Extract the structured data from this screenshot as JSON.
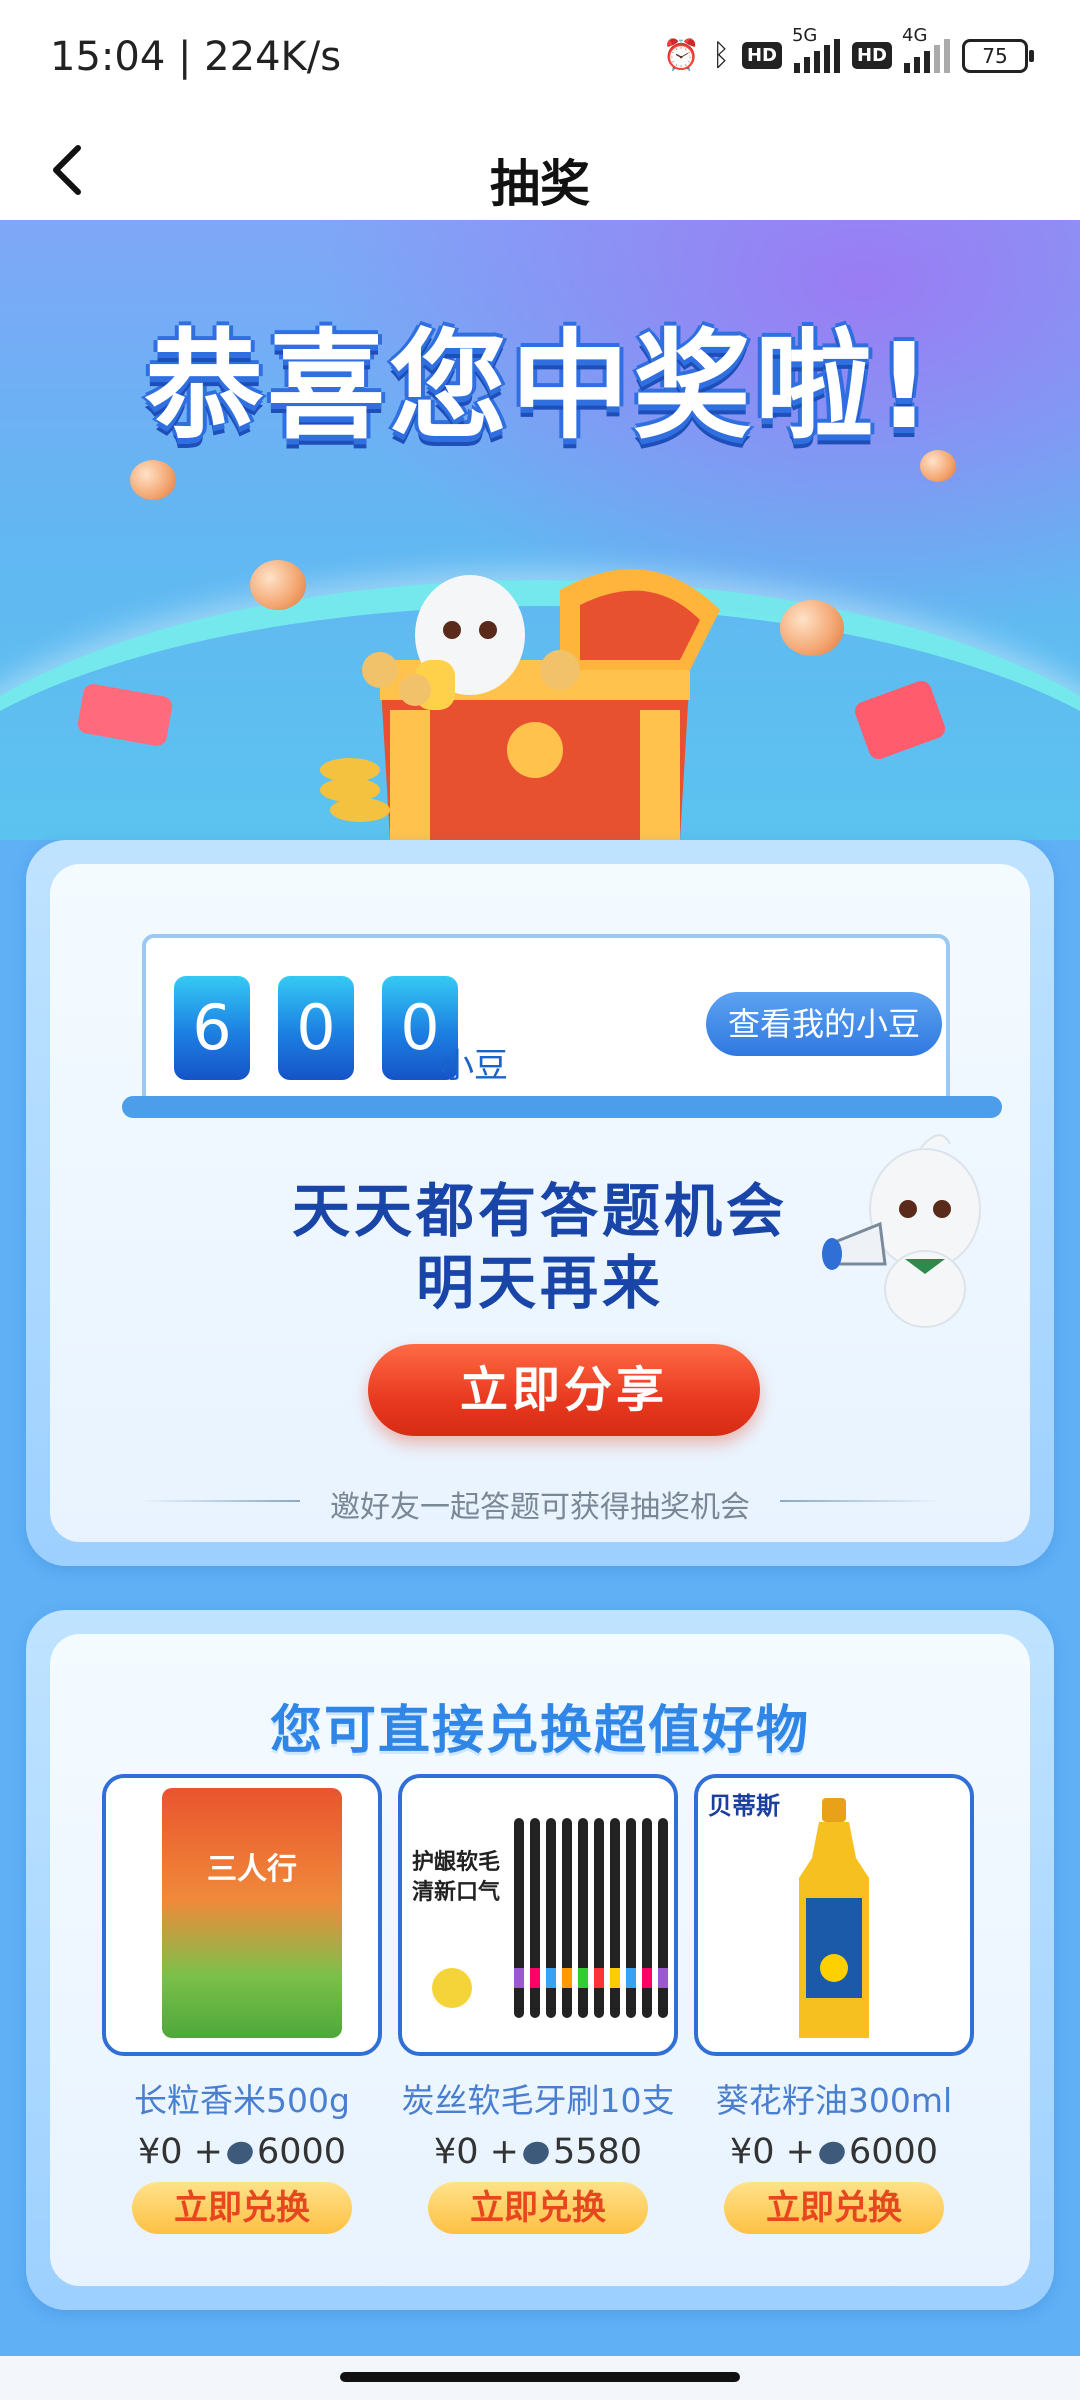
{
  "status_bar": {
    "time": "15:04 | 224K/s",
    "network_5g": "5G",
    "network_4g": "4G",
    "hd": "HD",
    "battery": "75"
  },
  "nav": {
    "title": "抽奖"
  },
  "hero": {
    "title": "恭喜您中奖啦!"
  },
  "score": {
    "digits": [
      "6",
      "0",
      "0"
    ],
    "unit": "小豆",
    "view_button": "查看我的小豆"
  },
  "message": {
    "line1": "天天都有答题机会",
    "line2": "明天再来"
  },
  "share": {
    "button": "立即分享",
    "hint": "邀好友一起答题可获得抽奖机会"
  },
  "exchange": {
    "title": "您可直接兑换超值好物",
    "products": [
      {
        "name": "长粒香米500g",
        "price": "¥0",
        "plus": "+",
        "beans": "6000",
        "button": "立即兑换",
        "brand": "三人行"
      },
      {
        "name": "炭丝软毛牙刷10支",
        "price": "¥0",
        "plus": "+",
        "beans": "5580",
        "button": "立即兑换",
        "brand_line1": "护龈软毛",
        "brand_line2": "清新口气"
      },
      {
        "name": "葵花籽油300ml",
        "price": "¥0",
        "plus": "+",
        "beans": "6000",
        "button": "立即兑换",
        "brand": "贝蒂斯"
      }
    ]
  }
}
